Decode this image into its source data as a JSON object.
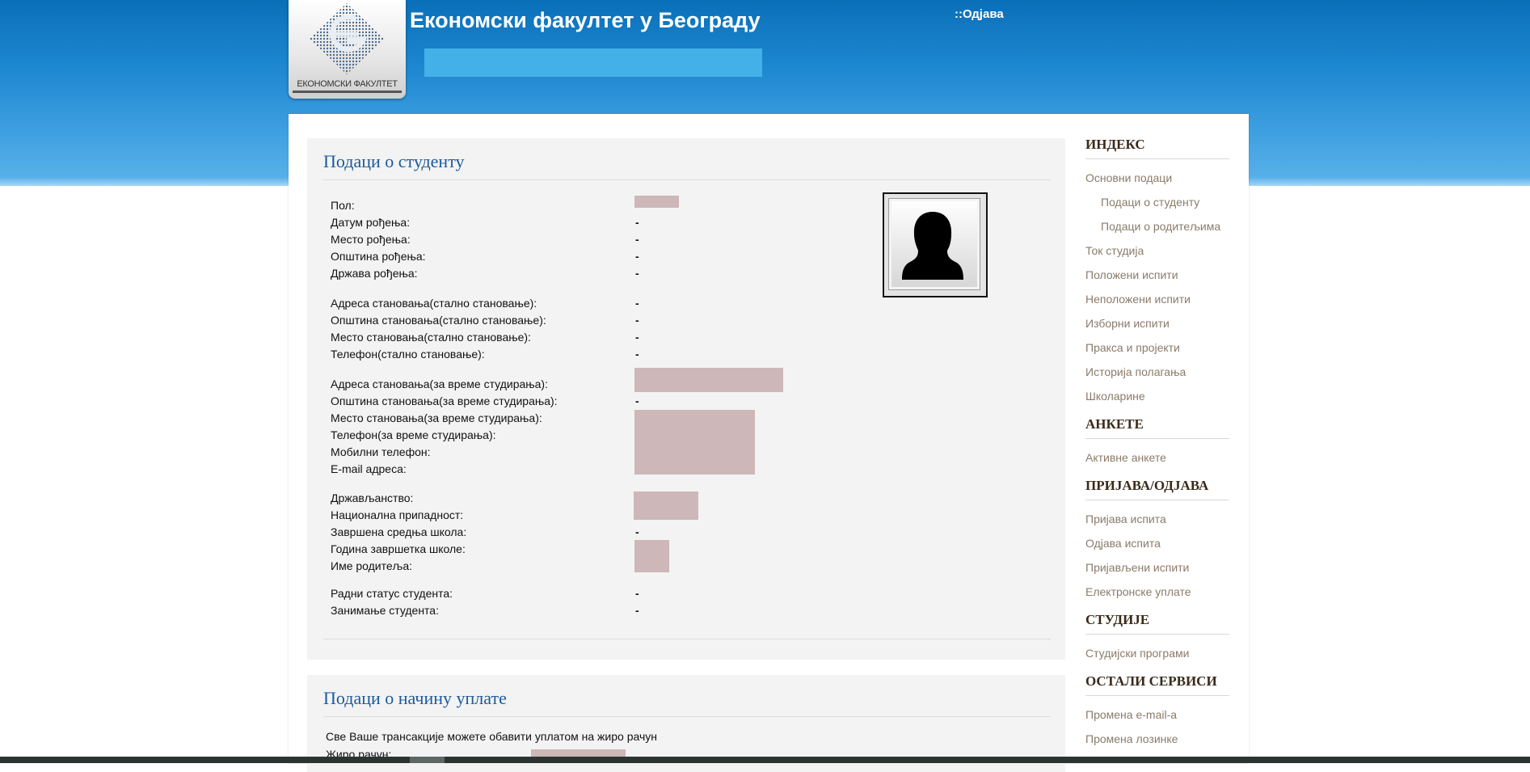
{
  "header": {
    "title": "Економски факултет у Београду",
    "logo_caption": "ЕКОНОМСКИ ФАКУЛТЕТ",
    "logout": "::Одјава"
  },
  "student": {
    "title": "Подаци о студенту",
    "groups": [
      [
        {
          "label": "Пол:",
          "value": ""
        },
        {
          "label": "Датум рођења:",
          "value": "-"
        },
        {
          "label": "Место рођења:",
          "value": "-"
        },
        {
          "label": "Општина рођења:",
          "value": "-"
        },
        {
          "label": "Држава рођења:",
          "value": "-"
        }
      ],
      [
        {
          "label": "Адреса становања(стално становање):",
          "value": "-"
        },
        {
          "label": "Општина становања(стално становање):",
          "value": "-"
        },
        {
          "label": "Место становања(стално становање):",
          "value": "-"
        },
        {
          "label": "Телефон(стално становање):",
          "value": "-"
        }
      ],
      [
        {
          "label": "Адреса становања(за време студирања):",
          "value": ""
        },
        {
          "label": "Општина становања(за време студирања):",
          "value": "-"
        },
        {
          "label": "Место становања(за време студирања):",
          "value": ""
        },
        {
          "label": "Телефон(за време студирања):",
          "value": ""
        },
        {
          "label": "Мобилни телефон:",
          "value": ""
        },
        {
          "label": "E-mail адреса:",
          "value": ""
        }
      ],
      [
        {
          "label": "Држављанство:",
          "value": ""
        },
        {
          "label": "Национална припадност:",
          "value": ""
        },
        {
          "label": "Завршена средња школа:",
          "value": "-"
        },
        {
          "label": "Година завршетка школе:",
          "value": ""
        },
        {
          "label": "Име родитеља:",
          "value": ""
        }
      ],
      [
        {
          "label": "Радни статус студента:",
          "value": "-"
        },
        {
          "label": "Занимање студента:",
          "value": "-"
        }
      ]
    ]
  },
  "payment": {
    "title": "Подаци о начину уплате",
    "text": "Све Ваше трансакције можете обавити уплатом на жиро рачун",
    "account_label": "Жиро рачун:"
  },
  "sidebar": {
    "sections": [
      {
        "title": "ИНДЕКС",
        "items": [
          {
            "label": "Основни подаци",
            "sub": false
          },
          {
            "label": "Подаци о студенту",
            "sub": true
          },
          {
            "label": "Подаци о родитељима",
            "sub": true
          },
          {
            "label": "Ток студија",
            "sub": false
          },
          {
            "label": "Положени испити",
            "sub": false
          },
          {
            "label": "Неположени испити",
            "sub": false
          },
          {
            "label": "Изборни испити",
            "sub": false
          },
          {
            "label": "Пракса и пројекти",
            "sub": false
          },
          {
            "label": "Историја полагања",
            "sub": false
          },
          {
            "label": "Школарине",
            "sub": false
          }
        ]
      },
      {
        "title": "АНКЕТЕ",
        "items": [
          {
            "label": "Активне анкете",
            "sub": false
          }
        ]
      },
      {
        "title": "ПРИЈАВА/ОДЈАВА",
        "items": [
          {
            "label": "Пријава испита",
            "sub": false
          },
          {
            "label": "Одјава испита",
            "sub": false
          },
          {
            "label": "Пријављени испити",
            "sub": false
          },
          {
            "label": "Електронске уплате",
            "sub": false
          }
        ]
      },
      {
        "title": "СТУДИЈЕ",
        "items": [
          {
            "label": "Студијски програми",
            "sub": false
          }
        ]
      },
      {
        "title": "ОСТАЛИ СЕРВИСИ",
        "items": [
          {
            "label": "Промена e-mail-a",
            "sub": false
          },
          {
            "label": "Промена лозинке",
            "sub": false
          }
        ]
      }
    ]
  }
}
